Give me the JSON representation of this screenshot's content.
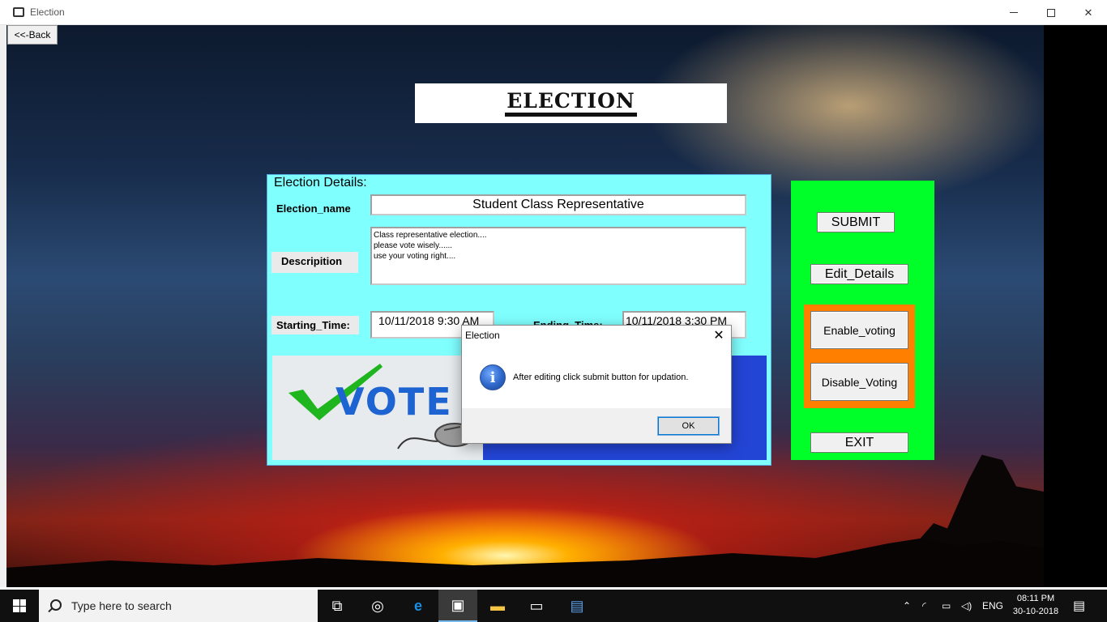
{
  "window": {
    "title": "Election"
  },
  "back_button": "<<-Back",
  "banner": {
    "title": "ELECTION"
  },
  "details": {
    "heading": "Election  Details:",
    "name_label": "Election_name",
    "name_value": "Student Class Representative",
    "description_label": "Descripition",
    "description_value": "Class representative election....\nplease vote wisely......\nuse your voting right....",
    "start_label": "Starting_Time:",
    "start_value": "10/11/2018 9:30 AM",
    "end_label": "Ending_Time:",
    "end_value": "10/11/2018 3:30 PM",
    "image_text": "VOTE"
  },
  "controls": {
    "submit": "SUBMIT",
    "edit": "Edit_Details",
    "enable": "Enable_voting",
    "disable": "Disable_Voting",
    "exit": "EXIT"
  },
  "dialog": {
    "title": "Election",
    "message": "After editing click submit button for updation.",
    "ok": "OK",
    "icon": "info-icon"
  },
  "taskbar": {
    "search_placeholder": "Type here to search",
    "language": "ENG",
    "time": "08:11 PM",
    "date": "30-10-2018"
  },
  "colors": {
    "details_bg": "#80ffff",
    "control_bg": "#00ff28",
    "toggle_group_bg": "#ff8000",
    "vote_blue": "#1e63d2"
  }
}
